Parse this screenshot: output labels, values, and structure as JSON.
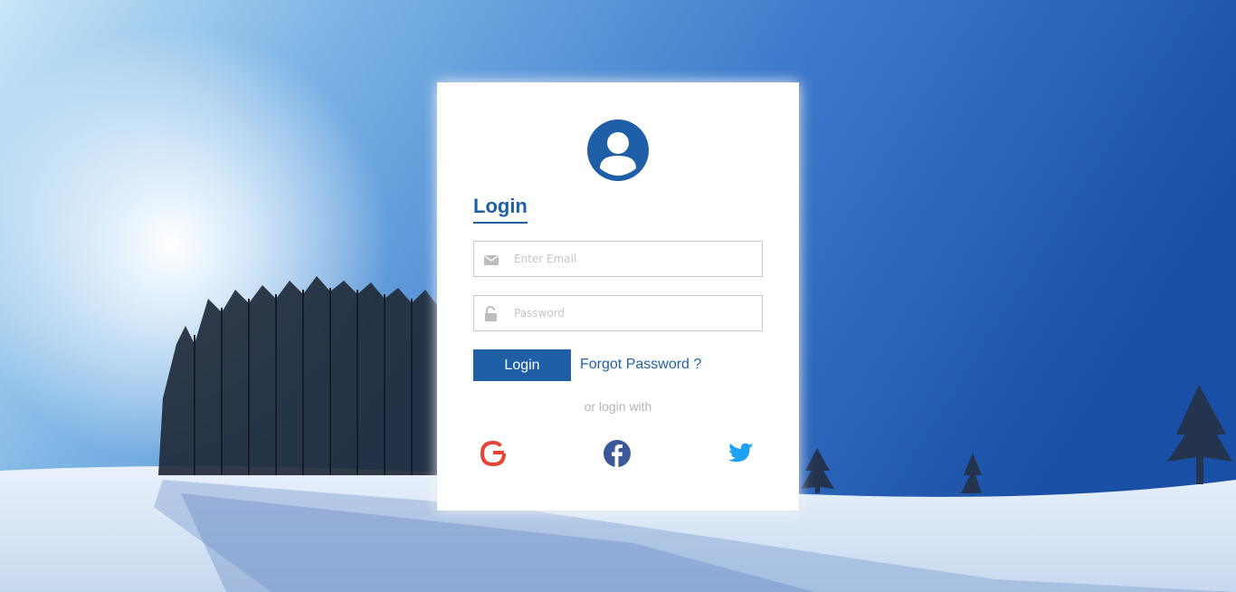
{
  "login_card": {
    "title": "Login",
    "email_placeholder": "Enter Email",
    "password_placeholder": "Password",
    "login_button": "Login",
    "forgot_password": "Forgot Password ?",
    "alt_login_text": "or login with"
  },
  "social": [
    {
      "name": "google",
      "icon": "google-icon"
    },
    {
      "name": "facebook",
      "icon": "facebook-icon"
    },
    {
      "name": "twitter",
      "icon": "twitter-icon"
    }
  ],
  "colors": {
    "accent": "#1f5fa8",
    "google": "#ea4335",
    "facebook": "#3b5998",
    "twitter": "#1da1f2"
  }
}
